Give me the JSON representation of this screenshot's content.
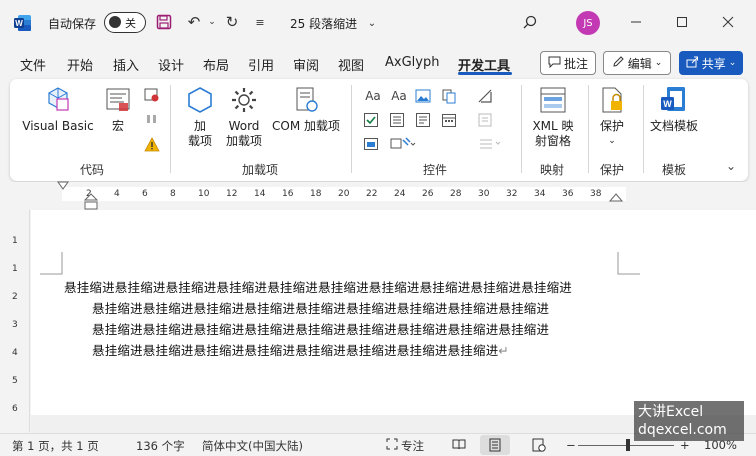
{
  "titlebar": {
    "autosave_label": "自动保存",
    "autosave_state": "关",
    "doc_title": "25 段落缩进",
    "avatar_initials": "JS"
  },
  "tabs": [
    "文件",
    "开始",
    "插入",
    "设计",
    "布局",
    "引用",
    "审阅",
    "视图",
    "AxGlyph",
    "开发工具"
  ],
  "active_tab": "开发工具",
  "actions": {
    "comment": "批注",
    "edit": "编辑",
    "share": "共享"
  },
  "ribbon": {
    "code": {
      "label": "代码",
      "visual_basic": "Visual Basic",
      "macro": "宏"
    },
    "addins": {
      "label": "加载项",
      "addin_line1": "加",
      "addin_line2": "载项",
      "word_addin_line1": "Word",
      "word_addin_line2": "加载项",
      "com_addin": "COM 加载项"
    },
    "controls": {
      "label": "控件",
      "aa1": "Aa",
      "aa2": "Aa"
    },
    "mapping": {
      "label": "映射",
      "xml_line1": "XML 映",
      "xml_line2": "射窗格"
    },
    "protect": {
      "label": "保护"
    },
    "templates": {
      "label": "模板",
      "doc_template": "文档模板"
    }
  },
  "ruler": {
    "numbers": [
      "2",
      "4",
      "6",
      "8",
      "10",
      "12",
      "14",
      "16",
      "18",
      "20",
      "22",
      "24",
      "26",
      "28",
      "30",
      "32",
      "34",
      "36",
      "38"
    ]
  },
  "vruler": {
    "numbers": [
      "1",
      "1",
      "2",
      "3",
      "4",
      "5",
      "6"
    ]
  },
  "document": {
    "lines": [
      "悬挂缩进悬挂缩进悬挂缩进悬挂缩进悬挂缩进悬挂缩进悬挂缩进悬挂缩进悬挂缩进悬挂缩进",
      "悬挂缩进悬挂缩进悬挂缩进悬挂缩进悬挂缩进悬挂缩进悬挂缩进悬挂缩进悬挂缩进",
      "悬挂缩进悬挂缩进悬挂缩进悬挂缩进悬挂缩进悬挂缩进悬挂缩进悬挂缩进悬挂缩进",
      "悬挂缩进悬挂缩进悬挂缩进悬挂缩进悬挂缩进悬挂缩进悬挂缩进悬挂缩进"
    ]
  },
  "status": {
    "page": "第 1 页，共 1 页",
    "words": "136 个字",
    "language": "简体中文(中国大陆)",
    "focus": "专注",
    "zoom": "100%"
  },
  "watermark": {
    "line1": "大讲Excel",
    "line2": "dqexcel.com"
  }
}
